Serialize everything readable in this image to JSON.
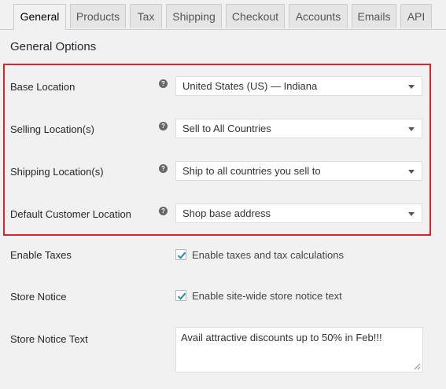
{
  "tabs": [
    "General",
    "Products",
    "Tax",
    "Shipping",
    "Checkout",
    "Accounts",
    "Emails",
    "API"
  ],
  "active_tab": "General",
  "section_title": "General Options",
  "help_glyph": "?",
  "location_settings": [
    {
      "label": "Base Location",
      "value": "United States (US) — Indiana"
    },
    {
      "label": "Selling Location(s)",
      "value": "Sell to All Countries"
    },
    {
      "label": "Shipping Location(s)",
      "value": "Ship to all countries you sell to"
    },
    {
      "label": "Default Customer Location",
      "value": "Shop base address"
    }
  ],
  "enable_taxes": {
    "label": "Enable Taxes",
    "checkbox_label": "Enable taxes and tax calculations",
    "checked": true
  },
  "store_notice": {
    "label": "Store Notice",
    "checkbox_label": "Enable site-wide store notice text",
    "checked": true
  },
  "store_notice_text": {
    "label": "Store Notice Text",
    "value": "Avail attractive discounts up to 50% in Feb!!!"
  },
  "colors": {
    "highlight": "#d9252b",
    "check": "#1e8cbe"
  }
}
